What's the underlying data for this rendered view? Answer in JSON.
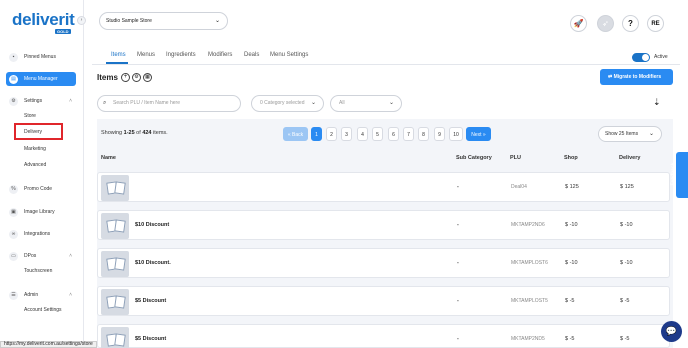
{
  "brand": {
    "logo": "deliverit",
    "logo_sub": "GOLD"
  },
  "sidebar": {
    "items": [
      {
        "label": "Pinned Menus",
        "icon": "pin-icon"
      },
      {
        "label": "Menu Manager",
        "icon": "menu-book-icon",
        "active": true
      },
      {
        "label": "Settings",
        "icon": "gear-icon"
      },
      {
        "label": "Promo Code",
        "icon": "promo-icon"
      },
      {
        "label": "Image Library",
        "icon": "image-icon"
      },
      {
        "label": "Integrations",
        "icon": "link-icon"
      },
      {
        "label": "DPos",
        "icon": "dpos-icon"
      },
      {
        "label": "Admin",
        "icon": "admin-icon"
      }
    ],
    "settings_sub": [
      "Store",
      "Delivery",
      "Marketing",
      "Advanced"
    ],
    "dpos_sub": [
      "Touchscreen"
    ],
    "admin_sub": [
      "Account Settings"
    ]
  },
  "topbar": {
    "store": "Studio Sample Store",
    "avatar": "RE",
    "help": "?"
  },
  "tabs": [
    "Items",
    "Menus",
    "Ingredients",
    "Modifiers",
    "Deals",
    "Menu Settings"
  ],
  "active_label": "Active",
  "items_title": "Items",
  "migrate_button": "Migrate to Modifiers",
  "search_placeholder": "Search PLU / Item Name here",
  "category_filter": "0 Category selected",
  "all_filter": "All",
  "showing": {
    "prefix": "Showing ",
    "range": "1-25",
    "of": " of ",
    "total": "424",
    "suffix": " items."
  },
  "pagination": {
    "back": "« Back",
    "pages": [
      "1",
      "2",
      "3",
      "4",
      "5",
      "6",
      "7",
      "8",
      "9",
      "10"
    ],
    "next": "Next »"
  },
  "per_page": "Show 25 Items",
  "columns": [
    "Name",
    "Sub Category",
    "PLU",
    "Shop",
    "Delivery"
  ],
  "rows": [
    {
      "name": "",
      "sub": "-",
      "plu": "Deal04",
      "shop": "$ 125",
      "delivery": "$ 125"
    },
    {
      "name": "$10 Discount",
      "sub": "-",
      "plu": "MKTAMP2ND6",
      "shop": "$ -10",
      "delivery": "$ -10"
    },
    {
      "name": "$10 Discount.",
      "sub": "-",
      "plu": "MKTAMPLOST6",
      "shop": "$ -10",
      "delivery": "$ -10"
    },
    {
      "name": "$5 Discount",
      "sub": "-",
      "plu": "MKTAMPLOST5",
      "shop": "$ -5",
      "delivery": "$ -5"
    },
    {
      "name": "$5 Discount",
      "sub": "-",
      "plu": "MKTAMP2ND5",
      "shop": "$ -5",
      "delivery": "$ -5"
    }
  ],
  "feedback": "Feedback",
  "status_url": "https://my.deliverit.com.au/settings/store",
  "colors": {
    "accent": "#2a8bf2",
    "brand": "#1a73c7",
    "highlight": "#e0262b"
  }
}
